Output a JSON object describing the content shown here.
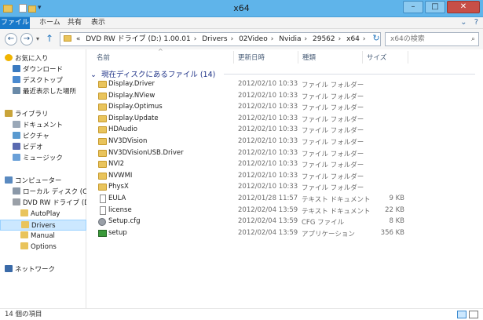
{
  "window": {
    "title": "x64"
  },
  "ribbon": {
    "tabs": [
      "ファイル",
      "ホーム",
      "共有",
      "表示"
    ],
    "help_icon": "help-icon"
  },
  "address": {
    "path": [
      "DVD RW ドライブ (D:) 1.00.01",
      "Drivers",
      "02Video",
      "Nvidia",
      "29562",
      "x64"
    ],
    "search_placeholder": "x64の検索"
  },
  "nav": {
    "items": [
      {
        "label": "お気に入り",
        "icon": "star-icon",
        "indent": 0
      },
      {
        "label": "ダウンロード",
        "icon": "download-icon",
        "indent": 1
      },
      {
        "label": "デスクトップ",
        "icon": "desktop-icon",
        "indent": 1
      },
      {
        "label": "最近表示した場所",
        "icon": "recent-places-icon",
        "indent": 1
      },
      {
        "label": "ライブラリ",
        "icon": "library-icon",
        "indent": 0
      },
      {
        "label": "ドキュメント",
        "icon": "documents-icon",
        "indent": 1
      },
      {
        "label": "ピクチャ",
        "icon": "pictures-icon",
        "indent": 1
      },
      {
        "label": "ビデオ",
        "icon": "video-icon",
        "indent": 1
      },
      {
        "label": "ミュージック",
        "icon": "music-icon",
        "indent": 1
      },
      {
        "label": "コンピューター",
        "icon": "computer-icon",
        "indent": 0
      },
      {
        "label": "ローカル ディスク (C:)",
        "icon": "drive-icon",
        "indent": 1
      },
      {
        "label": "DVD RW ドライブ (D:",
        "icon": "dvd-drive-icon",
        "indent": 1
      },
      {
        "label": "AutoPlay",
        "icon": "folder-icon",
        "indent": 2
      },
      {
        "label": "Drivers",
        "icon": "folder-icon",
        "indent": 2,
        "selected": true
      },
      {
        "label": "Manual",
        "icon": "folder-icon",
        "indent": 2
      },
      {
        "label": "Options",
        "icon": "folder-icon",
        "indent": 2
      },
      {
        "label": "ネットワーク",
        "icon": "network-icon",
        "indent": 0
      }
    ]
  },
  "columns": [
    "名前",
    "更新日時",
    "種類",
    "サイズ"
  ],
  "group_label": "現在ディスクにあるファイル (14)",
  "files": [
    {
      "name": "Display.Driver",
      "date": "2012/02/10 10:33",
      "type": "ファイル フォルダー",
      "size": "",
      "icon": "folder-icon"
    },
    {
      "name": "Display.NView",
      "date": "2012/02/10 10:33",
      "type": "ファイル フォルダー",
      "size": "",
      "icon": "folder-icon"
    },
    {
      "name": "Display.Optimus",
      "date": "2012/02/10 10:33",
      "type": "ファイル フォルダー",
      "size": "",
      "icon": "folder-icon"
    },
    {
      "name": "Display.Update",
      "date": "2012/02/10 10:33",
      "type": "ファイル フォルダー",
      "size": "",
      "icon": "folder-icon"
    },
    {
      "name": "HDAudio",
      "date": "2012/02/10 10:33",
      "type": "ファイル フォルダー",
      "size": "",
      "icon": "folder-icon"
    },
    {
      "name": "NV3DVision",
      "date": "2012/02/10 10:33",
      "type": "ファイル フォルダー",
      "size": "",
      "icon": "folder-icon"
    },
    {
      "name": "NV3DVisionUSB.Driver",
      "date": "2012/02/10 10:33",
      "type": "ファイル フォルダー",
      "size": "",
      "icon": "folder-icon"
    },
    {
      "name": "NVI2",
      "date": "2012/02/10 10:33",
      "type": "ファイル フォルダー",
      "size": "",
      "icon": "folder-icon"
    },
    {
      "name": "NVWMI",
      "date": "2012/02/10 10:33",
      "type": "ファイル フォルダー",
      "size": "",
      "icon": "folder-icon"
    },
    {
      "name": "PhysX",
      "date": "2012/02/10 10:33",
      "type": "ファイル フォルダー",
      "size": "",
      "icon": "folder-icon"
    },
    {
      "name": "EULA",
      "date": "2012/01/28 11:57",
      "type": "テキスト ドキュメント",
      "size": "9 KB",
      "icon": "text-document-icon"
    },
    {
      "name": "license",
      "date": "2012/02/04 13:59",
      "type": "テキスト ドキュメント",
      "size": "22 KB",
      "icon": "text-document-icon"
    },
    {
      "name": "Setup.cfg",
      "date": "2012/02/04 13:59",
      "type": "CFG ファイル",
      "size": "8 KB",
      "icon": "config-file-icon"
    },
    {
      "name": "setup",
      "date": "2012/02/04 13:59",
      "type": "アプリケーション",
      "size": "356 KB",
      "icon": "application-icon"
    }
  ],
  "status": {
    "count": "14 個の項目"
  }
}
